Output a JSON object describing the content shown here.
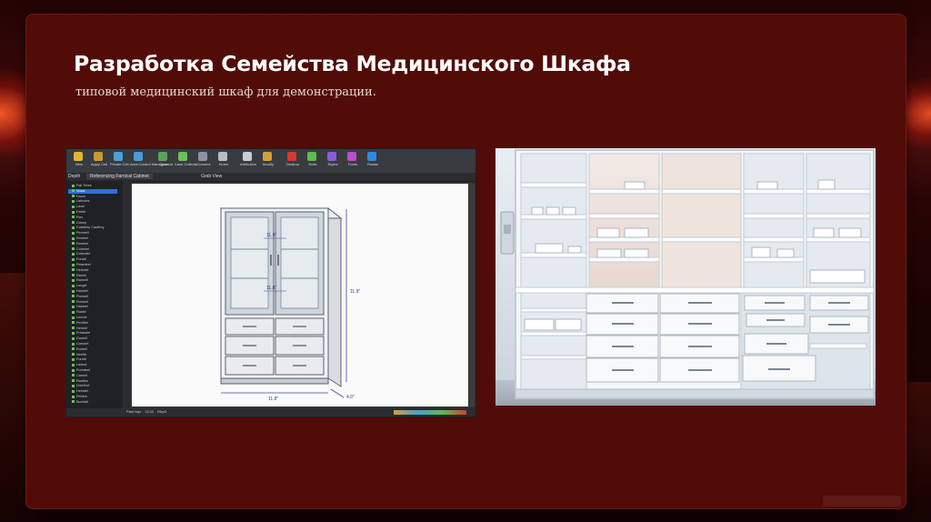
{
  "slide": {
    "title": "Разработка Семейства Медицинского Шкафа",
    "subtitle": "типовой медицинский шкаф для демонстрации."
  },
  "cad_screenshot": {
    "toolbar_buttons": [
      {
        "label": "New",
        "icon": "star-icon",
        "color": "#e6b430"
      },
      {
        "label": "Apply Cell",
        "icon": "curve-icon",
        "color": "#c99a2e"
      },
      {
        "label": "Private Cell",
        "icon": "curve-icon",
        "color": "#4aa0d8"
      },
      {
        "label": "Area Control Management",
        "icon": "grid-icon",
        "color": "#4a9ad8"
      },
      {
        "label": "Case",
        "icon": "box-icon",
        "color": "#5aa35a"
      },
      {
        "label": "Case Collects",
        "icon": "box-icon",
        "color": "#6cc05a"
      },
      {
        "label": "Connect",
        "icon": "link-icon",
        "color": "#8c93a0"
      },
      {
        "label": "Home",
        "icon": "home-icon",
        "color": "#b8bcc4"
      },
      {
        "label": "Attribution",
        "icon": "tag-icon",
        "color": "#c9cdd3"
      },
      {
        "label": "Modify",
        "icon": "wrench-icon",
        "color": "#d4a030"
      },
      {
        "label": "Destroy",
        "icon": "cross-icon",
        "color": "#d83a2e"
      },
      {
        "label": "Rolls",
        "icon": "leaf-icon",
        "color": "#5cbf4a"
      },
      {
        "label": "Styles",
        "icon": "palette-icon",
        "color": "#8c5ad8"
      },
      {
        "label": "Fonts",
        "icon": "font-icon",
        "color": "#c04ad0"
      },
      {
        "label": "Rotate",
        "icon": "rotate-icon",
        "color": "#2a8be0"
      }
    ],
    "tabs": [
      "Depth",
      "Referencing Farnical Cabinet",
      "Grab View"
    ],
    "tree_items": [
      "Fall Trees",
      "Stack",
      "Doors",
      "Latholes",
      "Lavel",
      "Dortel",
      "Flex",
      "Caney",
      "Curtainty Cauffrey",
      "Penmell",
      "Romhel",
      "Romhel",
      "Colmhel",
      "Colendel",
      "Forald",
      "Fleambel",
      "Herndel",
      "Rannil",
      "Rannell",
      "Longel",
      "Hanntel",
      "Parmell",
      "Romeel",
      "Haweel",
      "Rastel",
      "Lennel",
      "Penthel",
      "Hennel",
      "Prhandel",
      "Dumell",
      "Carndel",
      "Romeil",
      "Neelth",
      "Furoth",
      "Lankot",
      "Pomdeel",
      "Carmel",
      "Rantles",
      "Drenthel",
      "Heestel",
      "Pebble",
      "Bornfall"
    ],
    "selected_tree_index": 1,
    "dimensions": {
      "top_label": "11.9\"",
      "middle_label": "11.8\"",
      "right_label": "11.9\"",
      "bottom_label": "11.8\"",
      "depth_label": "4.0\""
    },
    "status_left": "Panl Nqe",
    "status_mid": "13.02",
    "status_right": "Rhyl3"
  },
  "photo": {
    "description_icon": "cabinet-photo"
  }
}
